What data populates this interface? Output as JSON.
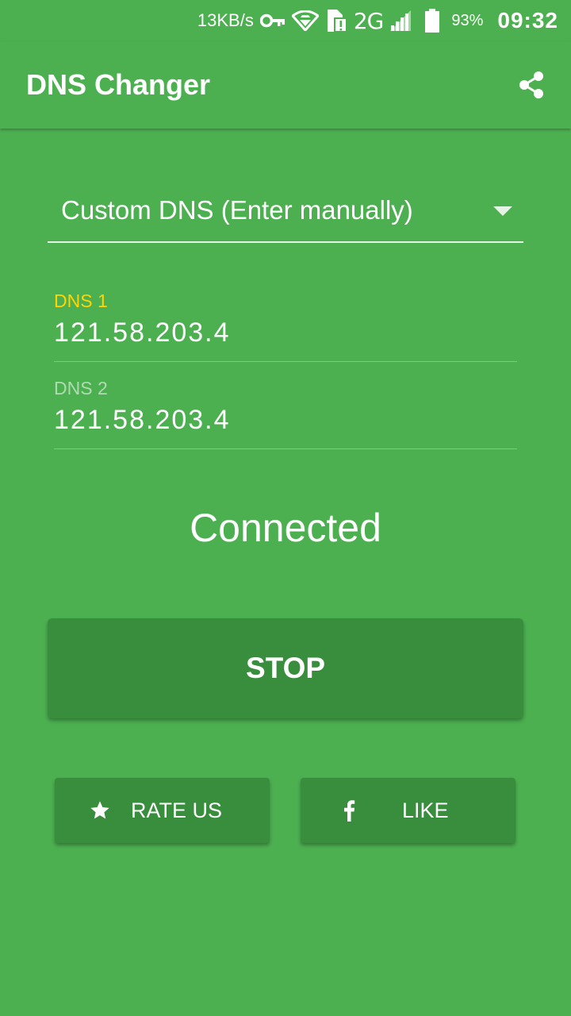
{
  "status_bar": {
    "network_speed": "13KB/s",
    "network_type": "2G",
    "battery_percent": "93%",
    "time": "09:32",
    "icons": [
      "vpn-key-icon",
      "wifi-icon",
      "sim-card-alert-icon",
      "signal-icon",
      "battery-icon"
    ]
  },
  "app_bar": {
    "title": "DNS Changer",
    "share_icon": "share-icon"
  },
  "dns_selector": {
    "selected": "Custom DNS (Enter manually)"
  },
  "dns1": {
    "label": "DNS 1",
    "value": "121.58.203.4"
  },
  "dns2": {
    "label": "DNS 2",
    "value": "121.58.203.4"
  },
  "connection_status": "Connected",
  "stop_button": {
    "label": "STOP"
  },
  "rate_button": {
    "label": "RATE US",
    "icon": "star-icon"
  },
  "like_button": {
    "label": "LIKE",
    "icon": "facebook-icon"
  },
  "colors": {
    "background": "#4caf50",
    "button": "#388e3c",
    "active_label": "#ffd400"
  }
}
